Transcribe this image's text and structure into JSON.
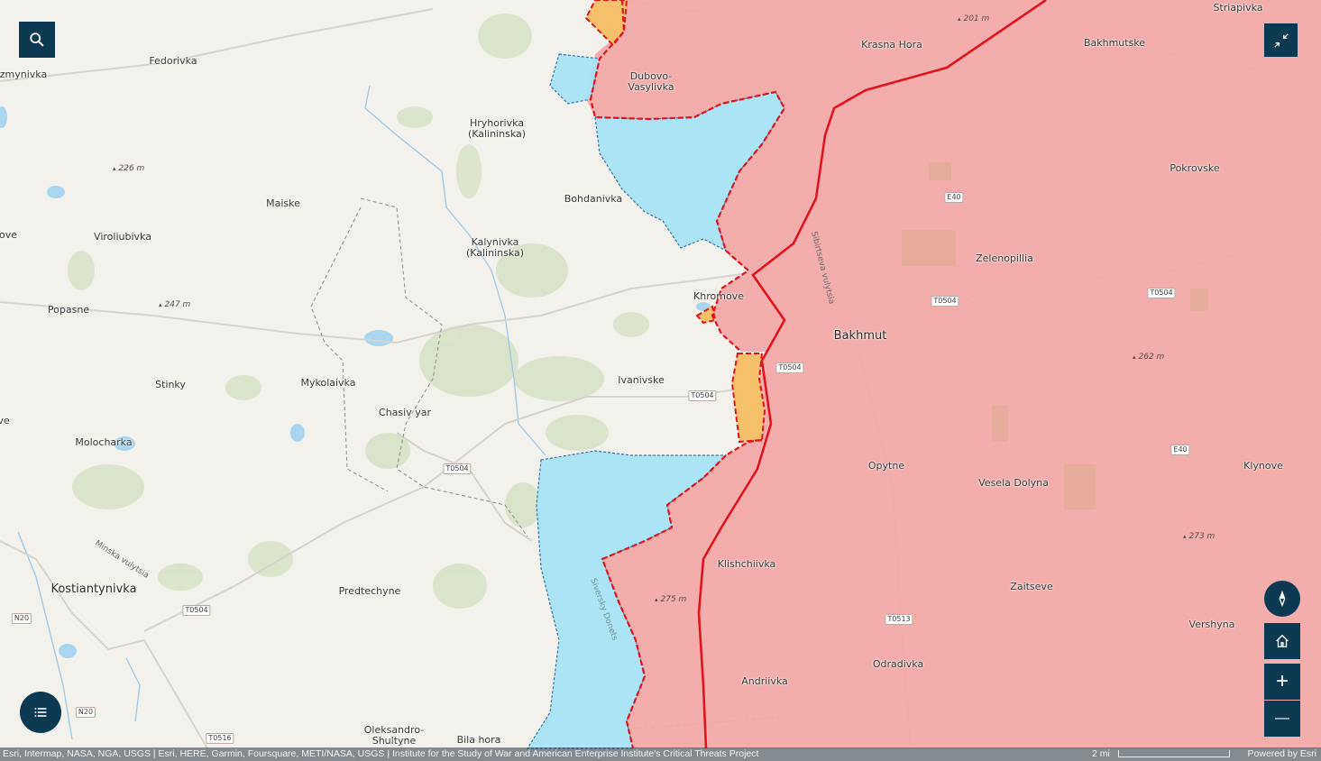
{
  "map": {
    "places": [
      {
        "id": "striapivka",
        "name": "Striapivka"
      },
      {
        "id": "bakhmutske",
        "name": "Bakhmutske"
      },
      {
        "id": "krasna-hora",
        "name": "Krasna Hora"
      },
      {
        "id": "fedorivka",
        "name": "Fedorivka"
      },
      {
        "id": "kuzmynivka",
        "name": "zmynivka"
      },
      {
        "id": "dubovo",
        "name": "Dubovo-\nVasylivka"
      },
      {
        "id": "hryhorivka",
        "name": "Hryhorivka\n(Kalininska)"
      },
      {
        "id": "pokrovske",
        "name": "Pokrovske"
      },
      {
        "id": "maiske",
        "name": "Maiske"
      },
      {
        "id": "bohdanivka",
        "name": "Bohdanivka"
      },
      {
        "id": "ove",
        "name": "ove"
      },
      {
        "id": "viroliubivka",
        "name": "Viroliubivka"
      },
      {
        "id": "kalynivka",
        "name": "Kalynivka\n(Kalininska)"
      },
      {
        "id": "zelenopillia",
        "name": "Zelenopillia"
      },
      {
        "id": "popasne",
        "name": "Popasne"
      },
      {
        "id": "khromove",
        "name": "Khromove"
      },
      {
        "id": "bakhmut",
        "name": "Bakhmut"
      },
      {
        "id": "stinky",
        "name": "Stinky"
      },
      {
        "id": "mykolaivka",
        "name": "Mykolaivka"
      },
      {
        "id": "ivanivske",
        "name": "Ivanivske"
      },
      {
        "id": "chasiv-yar",
        "name": "Chasiv yar"
      },
      {
        "id": "ve",
        "name": "ve"
      },
      {
        "id": "molocharka",
        "name": "Molocharka"
      },
      {
        "id": "opytne",
        "name": "Opytne"
      },
      {
        "id": "vesela-dolyna",
        "name": "Vesela Dolyna"
      },
      {
        "id": "klynove",
        "name": "Klynove"
      },
      {
        "id": "klishchiivka",
        "name": "Klishchiivka"
      },
      {
        "id": "kostiantynivka",
        "name": "Kostiantynivka"
      },
      {
        "id": "predtechyne",
        "name": "Predtechyne"
      },
      {
        "id": "zaitseve",
        "name": "Zaitseve"
      },
      {
        "id": "vershyna",
        "name": "Vershyna"
      },
      {
        "id": "odradivka",
        "name": "Odradivka"
      },
      {
        "id": "andriivka",
        "name": "Andriivka"
      },
      {
        "id": "oleksandro",
        "name": "Oleksandro-\nShultyne"
      },
      {
        "id": "bila-hora",
        "name": "Bila hora"
      }
    ],
    "elevations": [
      {
        "id": "e201",
        "text": "201 m"
      },
      {
        "id": "e226",
        "text": "226 m"
      },
      {
        "id": "e247",
        "text": "247 m"
      },
      {
        "id": "e262",
        "text": "262 m"
      },
      {
        "id": "e273",
        "text": "273 m"
      },
      {
        "id": "e275",
        "text": "275 m"
      }
    ],
    "roads": [
      {
        "id": "r1",
        "text": "E40"
      },
      {
        "id": "r2",
        "text": "T0504"
      },
      {
        "id": "r3",
        "text": "T0504"
      },
      {
        "id": "r4",
        "text": "T0504"
      },
      {
        "id": "r5",
        "text": "T0504"
      },
      {
        "id": "r6",
        "text": "E40"
      },
      {
        "id": "r7",
        "text": "T0504"
      },
      {
        "id": "r8",
        "text": "T0504"
      },
      {
        "id": "r9",
        "text": "N20"
      },
      {
        "id": "r10",
        "text": "N20"
      },
      {
        "id": "r11",
        "text": "T0513"
      },
      {
        "id": "r12",
        "text": "T0516"
      }
    ],
    "streets": [
      {
        "id": "s1",
        "text": "Sibirtseva vulytsia"
      },
      {
        "id": "s2",
        "text": "Minska vulytsia"
      },
      {
        "id": "s3",
        "text": "Siversky Donets"
      }
    ],
    "colors": {
      "occupied": "#f4a7a7",
      "contested": "#f7c06d",
      "liberated": "#a7e3f5",
      "frontline": "#e0151b",
      "button": "#0c3a52"
    }
  },
  "controls": {
    "search_icon": "search-icon",
    "collapse_icon": "collapse-icon",
    "compass_icon": "compass-icon",
    "home_icon": "home-icon",
    "zoom_in_label": "+",
    "zoom_out_label": "—",
    "legend_icon": "list-icon"
  },
  "attribution": {
    "sources": "Esri, Intermap, NASA, NGA, USGS | Esri, HERE, Garmin, Foursquare, METI/NASA, USGS | Institute for the Study of War and American Enterprise Institute's Critical Threats Project",
    "scale_label": "2 mi",
    "powered_by": "Powered by Esri"
  }
}
